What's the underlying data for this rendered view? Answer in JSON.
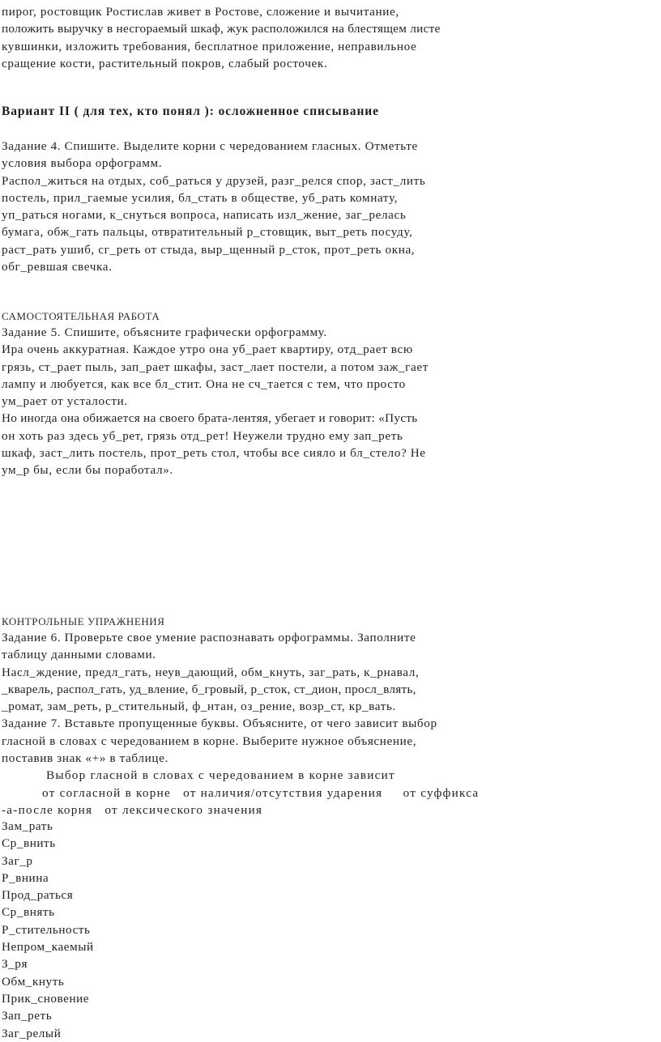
{
  "document": {
    "type": "worksheet-scan",
    "language": "ru",
    "background_color": "#ffffff",
    "text_color": "#232323"
  },
  "intro_paragraph": {
    "lines": [
      "пирог, ростовщик Ростислав живет в Ростове, сложение и вычитание,",
      "положить выручку в несгораемый шкаф, жук расположился на блестящем листе",
      "кувшинки, изложить требования, бесплатное приложение, неправильное",
      "сращение кости, растительный покров, слабый росточек."
    ]
  },
  "variant_heading": {
    "text": "Вариант II ( для тех, кто понял ): осложненное списывание"
  },
  "task4": {
    "instruction_lines": [
      "Задание 4. Спишите. Выделите корни с чередованием гласных. Отметьте",
      "условия выбора орфограмм."
    ],
    "word_lines": [
      "Распол_житься на отдых, соб_раться у друзей, разг_релся спор, заст_лить",
      "постель, прил_гаемые усилия, бл_стать в обществе, уб_рать комнату,",
      "уп_раться ногами, к_снуться вопроса, написать изл_жение, заг_релась",
      "бумага, обж_гать пальцы, отвратительный р_стовщик, выт_реть посуду,",
      "раст_рать ушиб, сг_реть от стыда, выр_щенный р_сток, прот_реть окна,",
      "обг_ревшая свечка."
    ]
  },
  "independent_work": {
    "caption": "САМОСТОЯТЕЛЬНАЯ РАБОТА",
    "task5_instruction": "Задание 5. Спишите, объясните графически орфограмму.",
    "paragraph1_lines": [
      "Ира очень аккуратная. Каждое утро она уб_рает квартиру, отд_рает всю",
      "грязь, ст_рает пыль, зап_рает шкафы, заст_лает постели, а потом заж_гает",
      "лампу и любуется, как все бл_стит. Она не сч_тается с тем, что просто",
      "ум_рает от усталости."
    ],
    "paragraph2_lines": [
      "Но иногда она обижается на своего брата-лентяя, убегает и говорит: «Пусть",
      "он хоть раз здесь уб_рет, грязь отд_рет! Неужели трудно ему зап_реть",
      "шкаф, заст_лить постель, прот_реть стол, чтобы все сияло и бл_стело? Не",
      "ум_р бы, если бы поработал»."
    ]
  },
  "control_exercises": {
    "caption": "КОНТРОЛЬНЫЕ УПРАЖНЕНИЯ",
    "task6_instruction_lines": [
      "Задание 6. Проверьте свое умение распознавать орфограммы. Заполните",
      "таблицу данными словами."
    ],
    "task6_word_lines": [
      "Насл_ждение, предл_гать, неув_дающий, обм_кнуть, заг_рать, к_рнавал,",
      "_кварель, распол_гать, уд_вление, б_гровый, р_сток, ст_дион, просл_влять,",
      "_ромат, зам_реть, р_стительный, ф_нтан, оз_рение, возр_ст, кр_вать."
    ],
    "task7_instruction_lines": [
      "Задание 7. Вставьте пропущенные буквы. Объясните, от чего зависит выбор",
      "гласной в словах с чередованием в корне. Выберите нужное объяснение,",
      "поставив знак «+» в таблице."
    ],
    "table_title": "Выбор гласной в словах с чередованием в корне зависит",
    "table_columns_line1": "от согласной в корне   от наличия/отсутствия ударения     от суффикса",
    "table_columns_line2": "-а-после корня   от лексического значения",
    "table_rows": [
      "Зам_рать",
      "Ср_внить",
      "Заг_р",
      "Р_внина",
      "Прод_раться",
      "Ср_внять",
      "Р_стительность",
      "Непром_каемый",
      "З_ря",
      "Обм_кнуть",
      "Прик_сновение",
      "Зап_реть",
      "Заг_релый"
    ]
  }
}
